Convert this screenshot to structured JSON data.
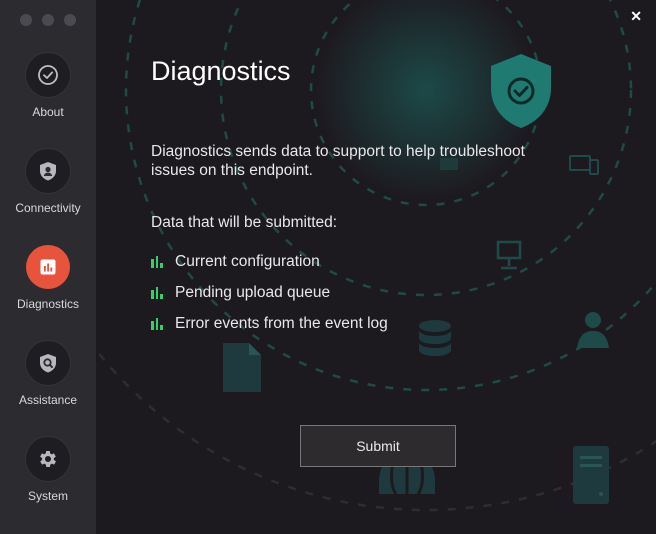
{
  "sidebar": {
    "items": [
      {
        "label": "About",
        "icon": "check-circle-icon",
        "active": false
      },
      {
        "label": "Connectivity",
        "icon": "shield-user-icon",
        "active": false
      },
      {
        "label": "Diagnostics",
        "icon": "bar-chart-icon",
        "active": true
      },
      {
        "label": "Assistance",
        "icon": "shield-search-icon",
        "active": false
      },
      {
        "label": "System",
        "icon": "gear-icon",
        "active": false
      }
    ]
  },
  "main": {
    "title": "Diagnostics",
    "description": "Diagnostics sends data to support to help troubleshoot issues on this endpoint.",
    "data_heading": "Data that will be submitted:",
    "data_items": [
      "Current configuration",
      "Pending upload queue",
      "Error events from the event log"
    ],
    "submit_label": "Submit",
    "close_label": "✕"
  },
  "colors": {
    "accent": "#e8533c",
    "bullet": "#2fd16b",
    "shield": "#1f7a72",
    "background": "#1d1a1f",
    "sidebar": "#2b2b30"
  }
}
